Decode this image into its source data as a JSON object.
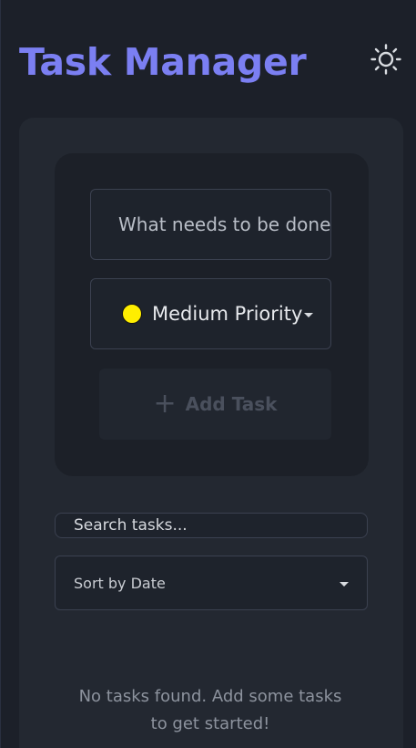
{
  "header": {
    "title": "Task Manager",
    "theme_icon": "sun-icon"
  },
  "form": {
    "task_placeholder": "What needs to be done?",
    "priority": {
      "selected_label": "Medium Priority",
      "selected_color": "#ffee00"
    },
    "add_button_label": "Add Task",
    "add_icon": "plus-icon"
  },
  "filters": {
    "search_placeholder": "Search tasks...",
    "sort_label": "Sort by Date"
  },
  "empty_state": {
    "message": "No tasks found. Add some tasks to get started!"
  },
  "colors": {
    "accent": "#7b7ff2",
    "background": "#1c2029",
    "panel": "#232831"
  }
}
